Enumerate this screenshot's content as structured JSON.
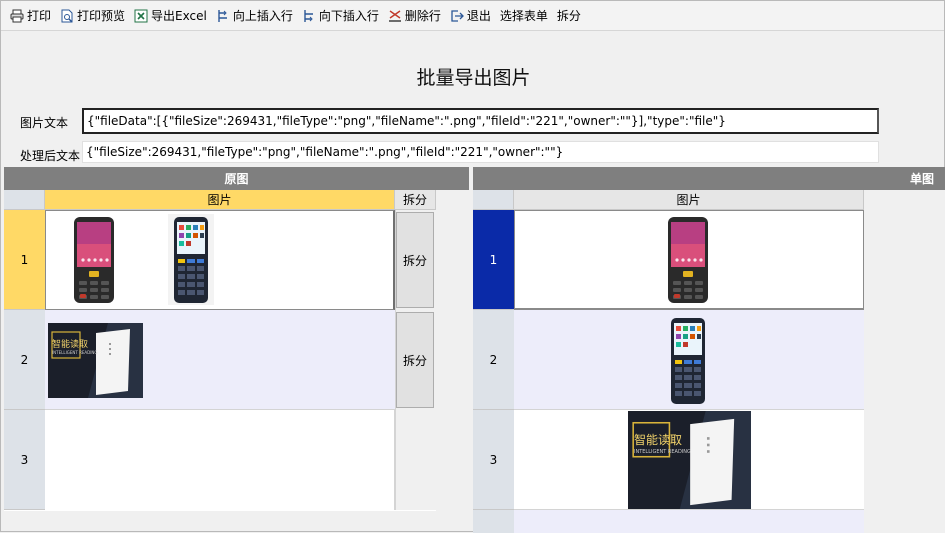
{
  "toolbar": {
    "print": "打印",
    "print_preview": "打印预览",
    "export_excel": "导出Excel",
    "insert_above": "向上插入行",
    "insert_below": "向下插入行",
    "delete_row": "删除行",
    "exit": "退出",
    "select_form": "选择表单",
    "split": "拆分"
  },
  "page": {
    "title": "批量导出图片",
    "image_text_label": "图片文本",
    "image_text_value": "{\"fileData\":[{\"fileSize\":269431,\"fileType\":\"png\",\"fileName\":\".png\",\"fileId\":\"221\",\"owner\":\"\"}],\"type\":\"file\"}",
    "processed_text_label": "处理后文本",
    "processed_text_value": "{\"fileSize\":269431,\"fileType\":\"png\",\"fileName\":\".png\",\"fileId\":\"221\",\"owner\":\"\"}"
  },
  "left_grid": {
    "header": "原图",
    "col_image": "图片",
    "col_split": "拆分",
    "rows": [
      {
        "num": "1",
        "split_label": "拆分"
      },
      {
        "num": "2",
        "split_label": "拆分"
      },
      {
        "num": "3"
      }
    ]
  },
  "right_grid": {
    "header": "单图",
    "col_image": "图片",
    "rows": [
      {
        "num": "1"
      },
      {
        "num": "2"
      },
      {
        "num": "3"
      }
    ]
  },
  "card_text": {
    "line1": "智能读取",
    "line2": "INTELLIGENT READING"
  },
  "colors": {
    "panel_header": "#7f7f7f",
    "selected_col_header": "#ffd966",
    "selected_row_header": "#ffd966",
    "right_selected_row": "#0a2aa8",
    "alt_row": "#ededfa"
  }
}
